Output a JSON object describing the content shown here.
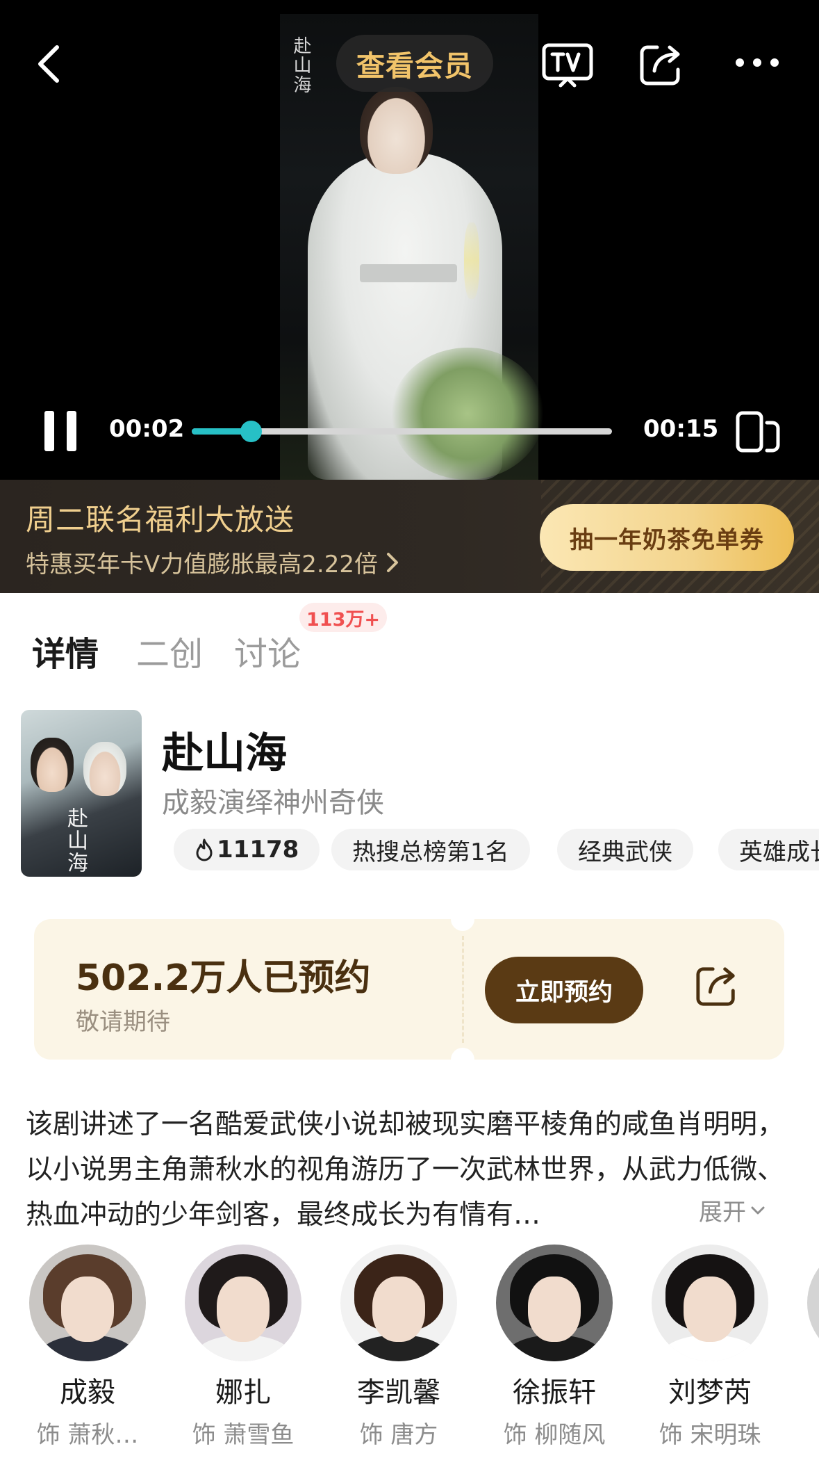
{
  "player": {
    "vip_label": "查看会员",
    "calligraphy": "赴山海",
    "current_time": "00:02",
    "total_time": "00:15",
    "progress": 0.14
  },
  "promo": {
    "title": "周二联名福利大放送",
    "subtitle": "特惠买年卡V力值膨胀最高2.22倍",
    "button": "抽一年奶茶免单券"
  },
  "tabs": [
    {
      "label": "详情",
      "active": true
    },
    {
      "label": "二创",
      "active": false
    },
    {
      "label": "讨论",
      "active": false,
      "badge": "113万+"
    }
  ],
  "show": {
    "poster_title": "赴山海",
    "title": "赴山海",
    "subtitle": "成毅演绎神州奇侠",
    "tags": [
      "11178",
      "热搜总榜第1名",
      "经典武侠",
      "英雄成长"
    ]
  },
  "reserve": {
    "count": "502.2万人已预约",
    "note": "敬请期待",
    "button": "立即预约"
  },
  "description": {
    "text": "该剧讲述了一名酷爱武侠小说却被现实磨平棱角的咸鱼肖明明，以小说男主角萧秋水的视角游历了一次武林世界，从武力低微、热血冲动的少年剑客，最终成长为有情有…",
    "expand": "展开"
  },
  "cast": [
    {
      "name": "成毅",
      "role": "饰 萧秋…"
    },
    {
      "name": "娜扎",
      "role": "饰 萧雪鱼"
    },
    {
      "name": "李凯馨",
      "role": "饰 唐方"
    },
    {
      "name": "徐振轩",
      "role": "饰 柳随风"
    },
    {
      "name": "刘梦芮",
      "role": "饰 宋明珠"
    }
  ],
  "colors": {
    "progress": "#27c0c6",
    "vip_gold": "#f2c46a",
    "promo_button": "#f3d48c",
    "reserve_button": "#5a3a14",
    "badge_red": "#f05050"
  }
}
